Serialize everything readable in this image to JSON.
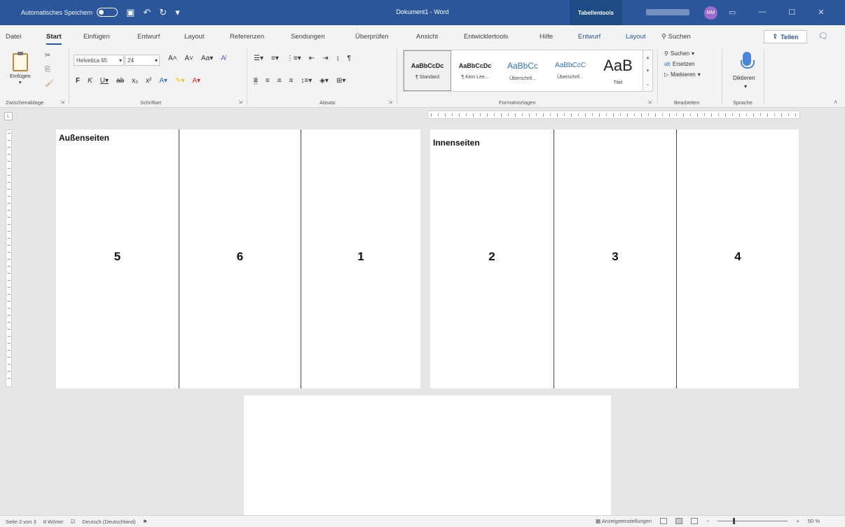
{
  "titlebar": {
    "autosave_label": "Automatisches Speichern",
    "document_title": "Dokument1 - Word",
    "context_tab": "Tabellentools",
    "avatar_initials": "MM"
  },
  "tabs": [
    "Datei",
    "Start",
    "Einfügen",
    "Entwurf",
    "Layout",
    "Referenzen",
    "Sendungen",
    "Überprüfen",
    "Ansicht",
    "Entwicklertools",
    "Hilfe",
    "Entwurf",
    "Layout"
  ],
  "search_label": "Suchen",
  "share_label": "Teilen",
  "ribbon": {
    "clipboard": {
      "paste_label": "Einfügen",
      "group_label": "Zwischenablage"
    },
    "font": {
      "font_name": "Helvetica 65",
      "font_size": "24",
      "group_label": "Schriftart"
    },
    "paragraph": {
      "group_label": "Absatz"
    },
    "styles": {
      "group_label": "Formatvorlagen",
      "items": [
        {
          "sample": "AaBbCcDc",
          "name": "¶ Standard"
        },
        {
          "sample": "AaBbCcDc",
          "name": "¶ Kein Lee..."
        },
        {
          "sample": "AaBbCc",
          "name": "Überschrif..."
        },
        {
          "sample": "AaBbCcC",
          "name": "Überschrif..."
        },
        {
          "sample": "AaB",
          "name": "Titel"
        }
      ]
    },
    "editing": {
      "group_label": "Bearbeiten",
      "find": "Suchen",
      "replace": "Ersetzen",
      "select": "Markieren"
    },
    "voice": {
      "dictate": "Diktieren",
      "group_label": "Sprache"
    }
  },
  "document": {
    "outer_title": "Außenseiten",
    "inner_title": "Innenseiten",
    "outer_panels": [
      "5",
      "6",
      "1"
    ],
    "inner_panels": [
      "2",
      "3",
      "4"
    ]
  },
  "status": {
    "page": "Seite 2 von 3",
    "words": "8 Wörter",
    "language": "Deutsch (Deutschland)",
    "display_settings": "Anzeigeeinstellungen",
    "zoom": "50 %",
    "zoom_value": 50
  },
  "colors": {
    "accent": "#2b579a",
    "context_tab": "#1e4a85",
    "avatar": "#9c6ad1"
  }
}
